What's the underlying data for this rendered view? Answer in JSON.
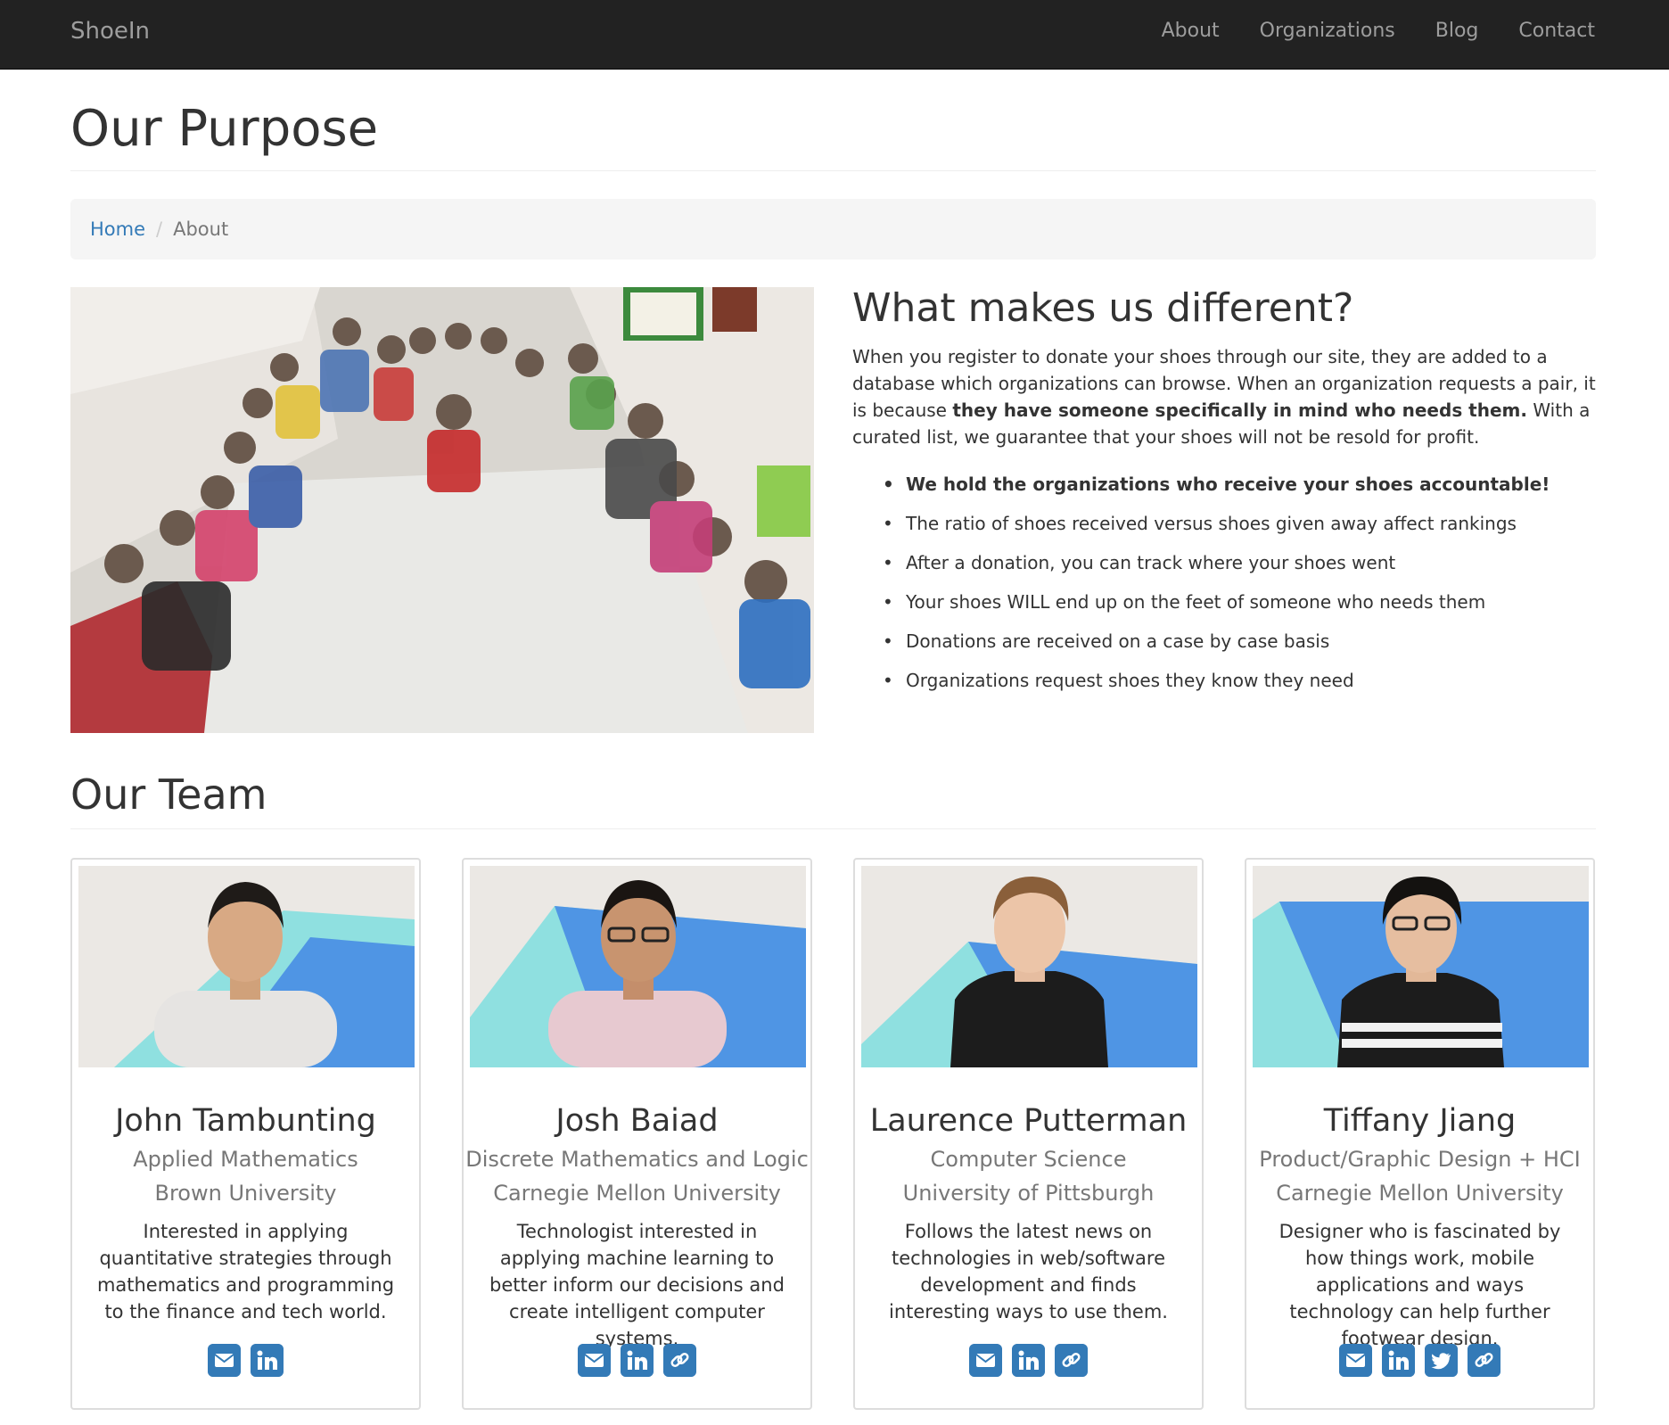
{
  "navbar": {
    "brand": "ShoeIn",
    "links": [
      "About",
      "Organizations",
      "Blog",
      "Contact"
    ]
  },
  "page": {
    "title": "Our Purpose"
  },
  "breadcrumb": {
    "home": "Home",
    "separator": "/",
    "current": "About"
  },
  "different": {
    "title": "What makes us different?",
    "para_1": "When you register to donate your shoes through our site, they are added to a database which organizations can browse. When an organization requests a pair, it is because ",
    "para_bold": "they have someone specifically in mind who needs them.",
    "para_2": " With a curated list, we guarantee that your shoes will not be resold for profit.",
    "bullets": [
      "We hold the organizations who receive your shoes accountable!",
      "The ratio of shoes received versus shoes given away affect rankings",
      "After a donation, you can track where your shoes went",
      "Your shoes WILL end up on the feet of someone who needs them",
      "Donations are received on a case by case basis",
      "Organizations request shoes they know they need"
    ]
  },
  "team": {
    "title": "Our Team",
    "members": [
      {
        "name": "John Tambunting",
        "major": "Applied Mathematics",
        "school": "Brown University",
        "bio": "Interested in applying quantitative strategies through mathematics and programming to the finance and tech world.",
        "icons": [
          "email-icon",
          "linkedin-icon"
        ]
      },
      {
        "name": "Josh Baiad",
        "major": "Discrete Mathematics and Logic",
        "school": "Carnegie Mellon University",
        "bio": "Technologist interested in applying machine learning to better inform our decisions and create intelligent computer systems.",
        "icons": [
          "email-icon",
          "linkedin-icon",
          "link-icon"
        ]
      },
      {
        "name": "Laurence Putterman",
        "major": "Computer Science",
        "school": "University of Pittsburgh",
        "bio": "Follows the latest news on technologies in web/software development and finds interesting ways to use them.",
        "icons": [
          "email-icon",
          "linkedin-icon",
          "link-icon"
        ]
      },
      {
        "name": "Tiffany Jiang",
        "major": "Product/Graphic Design + HCI",
        "school": "Carnegie Mellon University",
        "bio": "Designer who is fascinated by how things work, mobile applications and ways technology can help further footwear design.",
        "icons": [
          "email-icon",
          "linkedin-icon",
          "twitter-icon",
          "link-icon"
        ]
      }
    ]
  },
  "colors": {
    "navbar_bg": "#222222",
    "nav_text": "#9d9d9d",
    "link_blue": "#337ab7",
    "muted_text": "#777777",
    "body_text": "#333333"
  }
}
